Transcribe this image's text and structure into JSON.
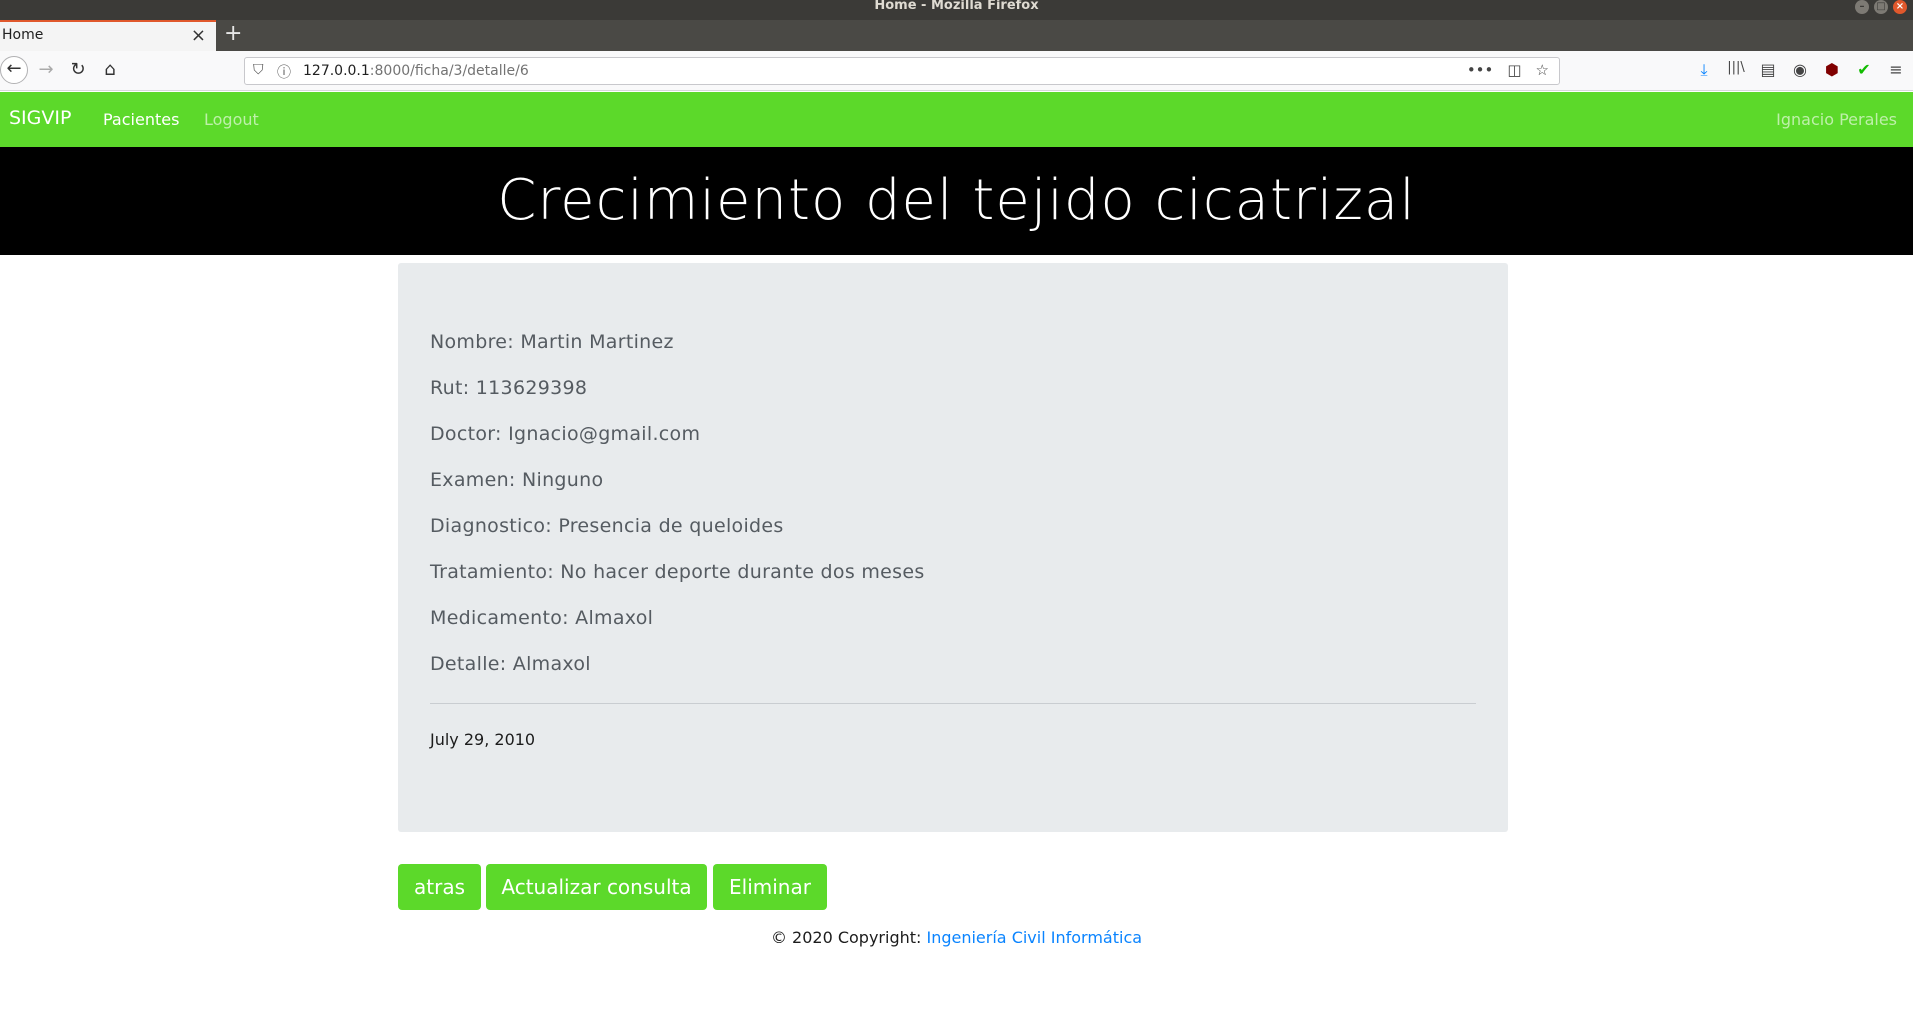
{
  "window": {
    "title": "Home - Mozilla Firefox",
    "controls": [
      "–",
      "□",
      "×"
    ]
  },
  "tab": {
    "title": "Home",
    "close": "×",
    "new_tab": "+"
  },
  "toolbar": {
    "back": "←",
    "forward": "→",
    "reload": "↻",
    "home": "⌂",
    "url_host": "127.0.0.1",
    "url_path": ":8000/ficha/3/detalle/6",
    "page_actions": "•••",
    "pocket": "◫",
    "bookmark": "☆",
    "download": "⤓",
    "library": "|||\\",
    "sidebar": "▤",
    "account": "◉",
    "ublock": "⬢",
    "extension": "✔",
    "menu": "≡"
  },
  "navbar": {
    "brand": "SIGVIP",
    "links": [
      "Pacientes",
      "Logout"
    ],
    "user": "Ignacio Perales"
  },
  "header": {
    "title": "Crecimiento del tejido cicatrizal"
  },
  "card": {
    "fields": [
      "Nombre: Martin Martinez",
      "Rut: 113629398",
      "Doctor: Ignacio@gmail.com",
      "Examen: Ninguno",
      "Diagnostico: Presencia de queloides",
      "Tratamiento: No hacer deporte durante dos meses",
      "Medicamento: Almaxol",
      "Detalle: Almaxol"
    ],
    "date": "July 29, 2010"
  },
  "actions": {
    "back": "atras",
    "update": "Actualizar consulta",
    "delete": "Eliminar"
  },
  "footer": {
    "text": "© 2020 Copyright: ",
    "link": "Ingeniería Civil Informática"
  },
  "colors": {
    "accent": "#5cd92a",
    "hero_bg": "#000000",
    "card_bg": "#e8ebed",
    "link": "#0a84ff"
  }
}
